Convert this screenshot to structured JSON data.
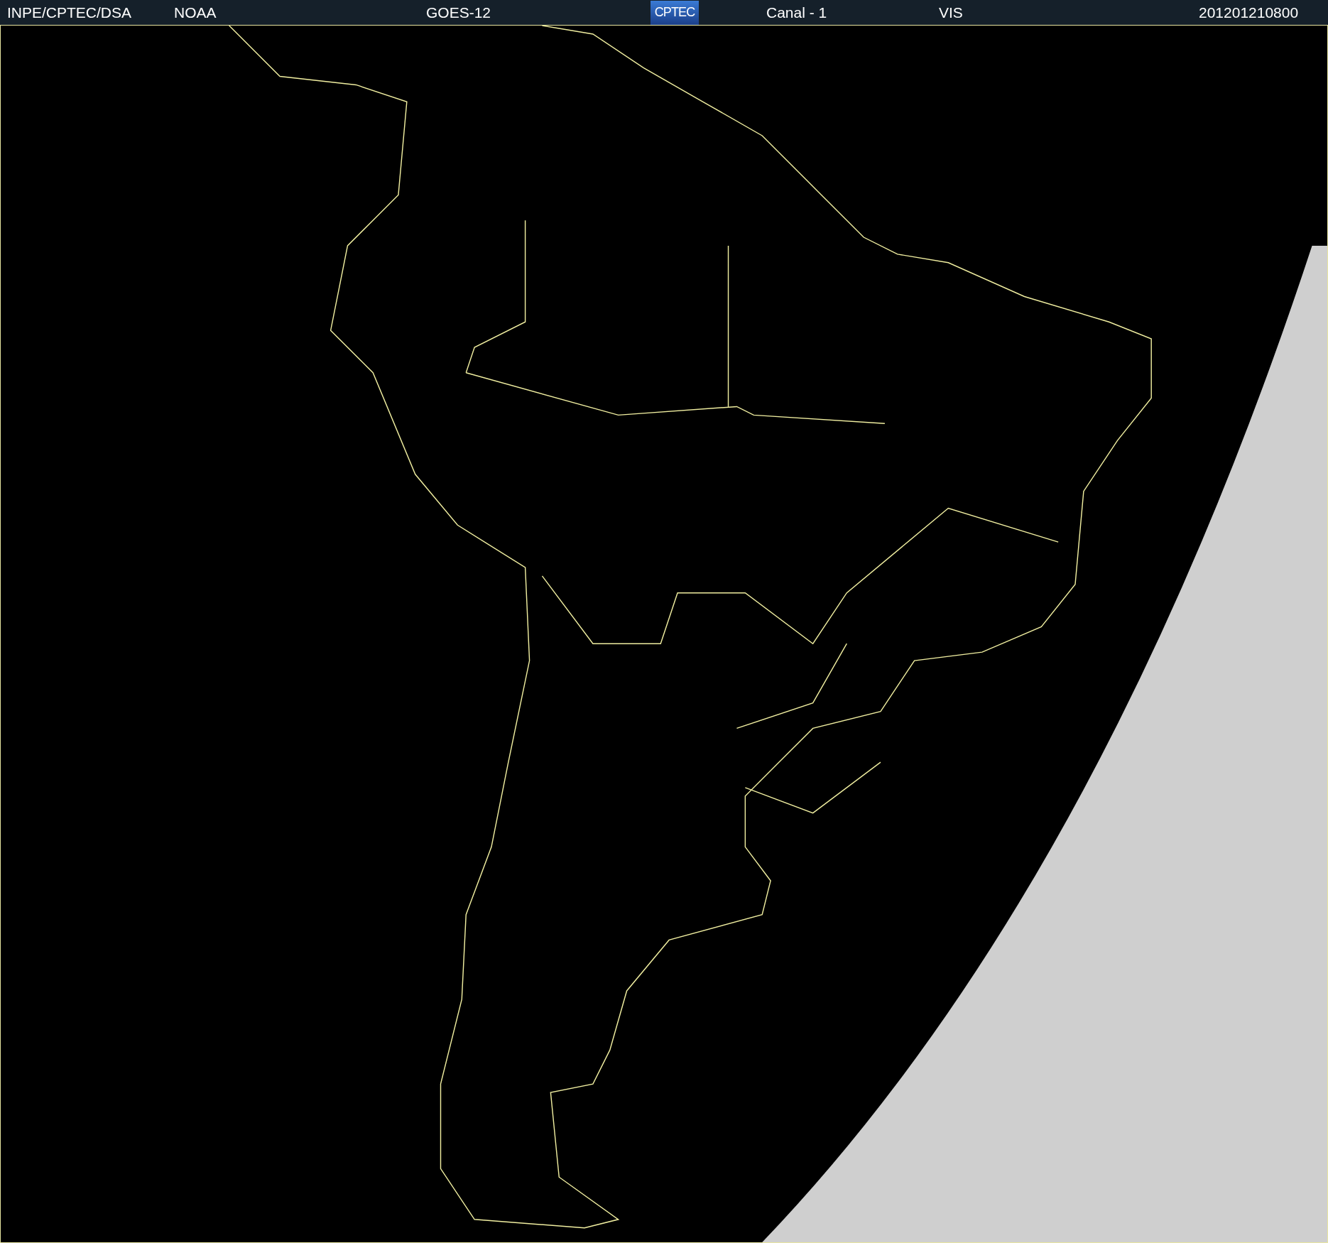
{
  "header": {
    "source": "INPE/CPTEC/DSA",
    "agency": "NOAA",
    "satellite": "GOES-12",
    "logo": "CPTEC",
    "channel": "Canal - 1",
    "band": "VIS",
    "timestamp": "201201210800"
  }
}
